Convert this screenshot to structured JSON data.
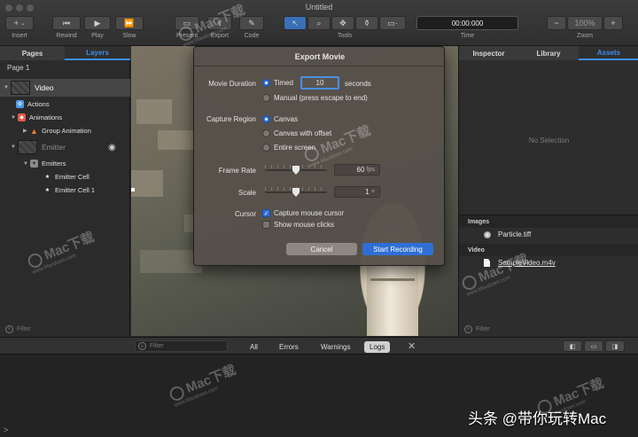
{
  "window": {
    "title": "Untitled"
  },
  "toolbar": {
    "insert_label": "Insert",
    "rewind_label": "Rewind",
    "play_label": "Play",
    "slow_label": "Slow",
    "present_label": "Present",
    "export_label": "Export",
    "code_label": "Code",
    "tools_label": "Tools",
    "time_value": "00:00:000",
    "time_label": "Time",
    "zoom_value": "100%",
    "zoom_label": "Zoom"
  },
  "left_panel": {
    "tabs": [
      {
        "label": "Pages"
      },
      {
        "label": "Layers"
      }
    ],
    "page_label": "Page 1",
    "layers": [
      {
        "label": "Video"
      },
      {
        "label": "Actions"
      },
      {
        "label": "Animations"
      },
      {
        "label": "Group Animation"
      },
      {
        "label": "Emitter"
      },
      {
        "label": "Emitters"
      },
      {
        "label": "Emitter Cell"
      },
      {
        "label": "Emitter Cell 1"
      }
    ],
    "filter_placeholder": "Filter"
  },
  "right_panel": {
    "tabs": [
      {
        "label": "Inspector"
      },
      {
        "label": "Library"
      },
      {
        "label": "Assets"
      }
    ],
    "no_selection": "No Selection",
    "sections": {
      "images": {
        "title": "Images",
        "items": [
          "Particle.tiff"
        ]
      },
      "video": {
        "title": "Video",
        "items": [
          "SampleVideo.m4v"
        ]
      }
    },
    "filter_placeholder": "Filter"
  },
  "log_bar": {
    "filter_placeholder": "Filter",
    "tabs": [
      {
        "label": "All"
      },
      {
        "label": "Errors"
      },
      {
        "label": "Warnings"
      },
      {
        "label": "Logs"
      }
    ],
    "prompt": ">"
  },
  "dialog": {
    "title": "Export Movie",
    "movie_duration": {
      "label": "Movie Duration",
      "timed_label": "Timed",
      "timed_value": "10",
      "seconds_label": "seconds",
      "manual_label": "Manual (press escape to end)",
      "selected": "timed"
    },
    "capture_region": {
      "label": "Capture Region",
      "options": [
        "Canvas",
        "Canvas with offset",
        "Entire screen"
      ],
      "selected": "Canvas"
    },
    "frame_rate": {
      "label": "Frame Rate",
      "value": "60",
      "unit": "fps",
      "level": 0.5
    },
    "scale": {
      "label": "Scale",
      "value": "1",
      "unit": "×",
      "level": 0.5
    },
    "cursor": {
      "label": "Cursor",
      "capture_label": "Capture mouse cursor",
      "capture_checked": true,
      "clicks_label": "Show mouse clicks",
      "clicks_checked": false
    },
    "cancel_label": "Cancel",
    "start_label": "Start Recording"
  },
  "watermarks": {
    "brand": "Mac下载",
    "url": "www.Macdown.com",
    "footer": "头条 @带你玩转Mac"
  },
  "colors": {
    "accent": "#2f6fd5",
    "selected_tab": "#3e8ee8"
  }
}
